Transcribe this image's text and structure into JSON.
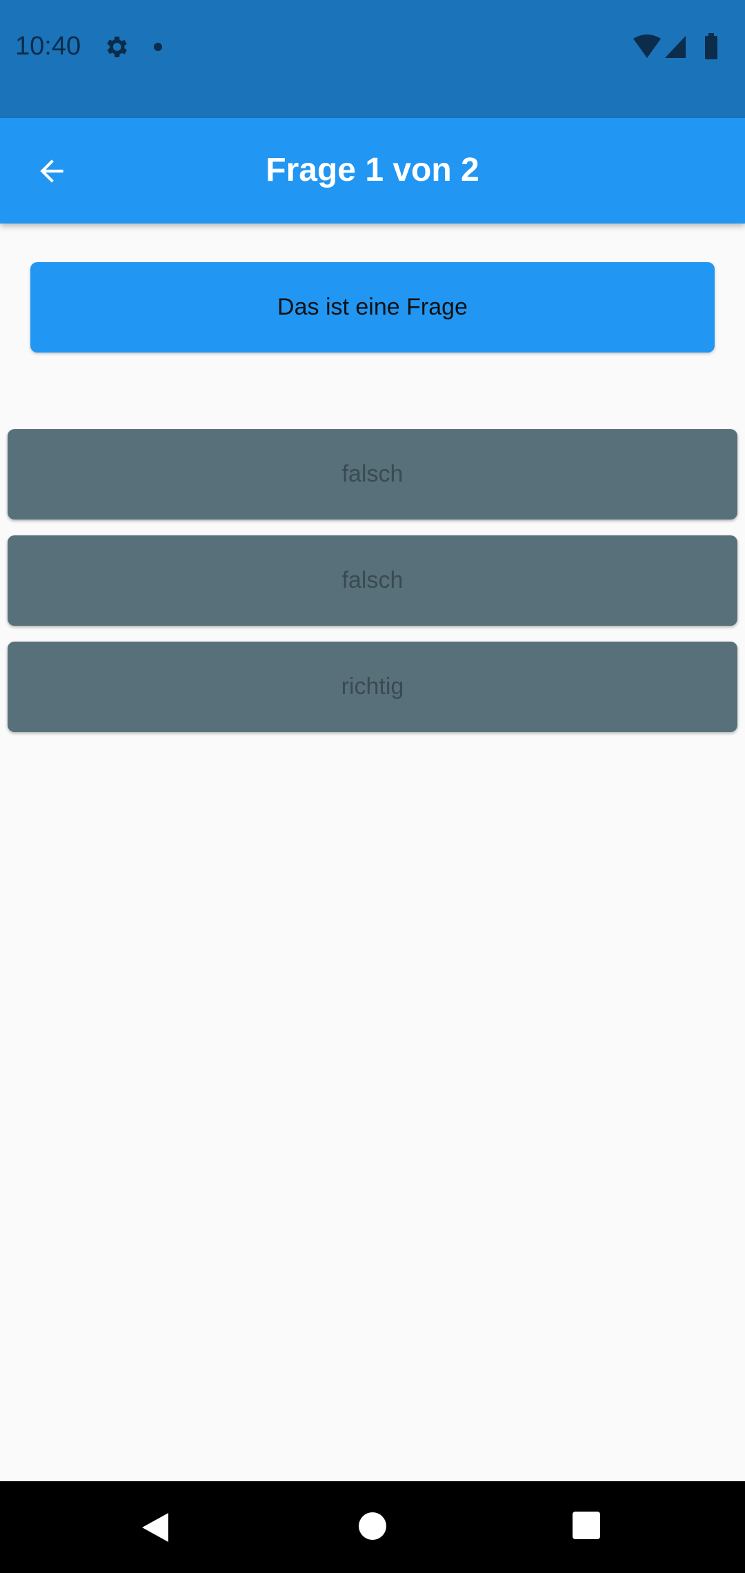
{
  "status_bar": {
    "time": "10:40",
    "icons": [
      "gear-icon",
      "dot-icon",
      "wifi-icon",
      "signal-icon",
      "battery-icon"
    ]
  },
  "app_bar": {
    "title": "Frage 1 von 2",
    "back_icon": "arrow-back-icon"
  },
  "question": {
    "text": "Das ist eine Frage"
  },
  "answers": [
    {
      "label": "falsch"
    },
    {
      "label": "falsch"
    },
    {
      "label": "richtig"
    }
  ],
  "nav_bar": {
    "icons": [
      "back-triangle-icon",
      "home-circle-icon",
      "recents-square-icon"
    ]
  },
  "colors": {
    "status_bar": "#1b73b9",
    "app_bar": "#2196f3",
    "answer": "#587079",
    "background": "#fafafa"
  }
}
